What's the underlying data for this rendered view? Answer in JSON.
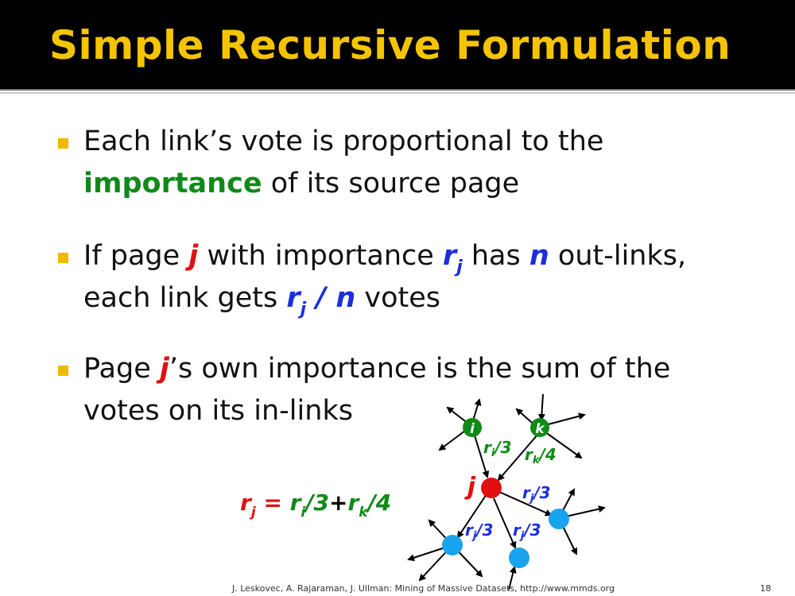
{
  "slide": {
    "title": "Simple Recursive Formulation",
    "footer": "J. Leskovec, A. Rajaraman, J. Ullman: Mining of Massive Datasets, http://www.mmds.org",
    "page_number": "18"
  },
  "bullets": [
    {
      "line1": "Each link’s vote is proportional to the",
      "line2_emph": "importance",
      "line2_rest": " of its source page"
    },
    {
      "line1_a": "If page ",
      "line1_j": "j",
      "line1_b": " with importance ",
      "line1_r": "r",
      "line1_rsub": "j",
      "line1_c": " has ",
      "line1_n": "n",
      "line1_d": " out-links,",
      "line2_a": "each link gets ",
      "line2_r": "r",
      "line2_rsub": "j",
      "line2_slash": " / ",
      "line2_n": "n",
      "line2_b": " votes"
    },
    {
      "line1_a": "Page ",
      "line1_j": "j",
      "line1_b": "’s own importance is the sum of the",
      "line2": "votes on its in-links"
    }
  ],
  "formula": {
    "lhs_r": "r",
    "lhs_sub": "j",
    "eq": " = ",
    "t1_r": "r",
    "t1_sub": "i",
    "t1_div": "/3",
    "plus": "+",
    "t2_r": "r",
    "t2_sub": "k",
    "t2_div": "/4"
  },
  "diagram": {
    "node_i": "i",
    "node_k": "k",
    "node_j": "j",
    "edge_i_j": {
      "r": "r",
      "sub": "i",
      "div": "/3"
    },
    "edge_k_j": {
      "r": "r",
      "sub": "k",
      "div": "/4"
    },
    "edge_j_out1": {
      "r": "r",
      "sub": "j",
      "div": "/3"
    },
    "edge_j_out2": {
      "r": "r",
      "sub": "j",
      "div": "/3"
    },
    "edge_j_out3": {
      "r": "r",
      "sub": "j",
      "div": "/3"
    },
    "colors": {
      "green": "#0f8a18",
      "red": "#e01010",
      "blue_node": "#1aa3ee",
      "blue_text": "#1b2ee0"
    }
  }
}
